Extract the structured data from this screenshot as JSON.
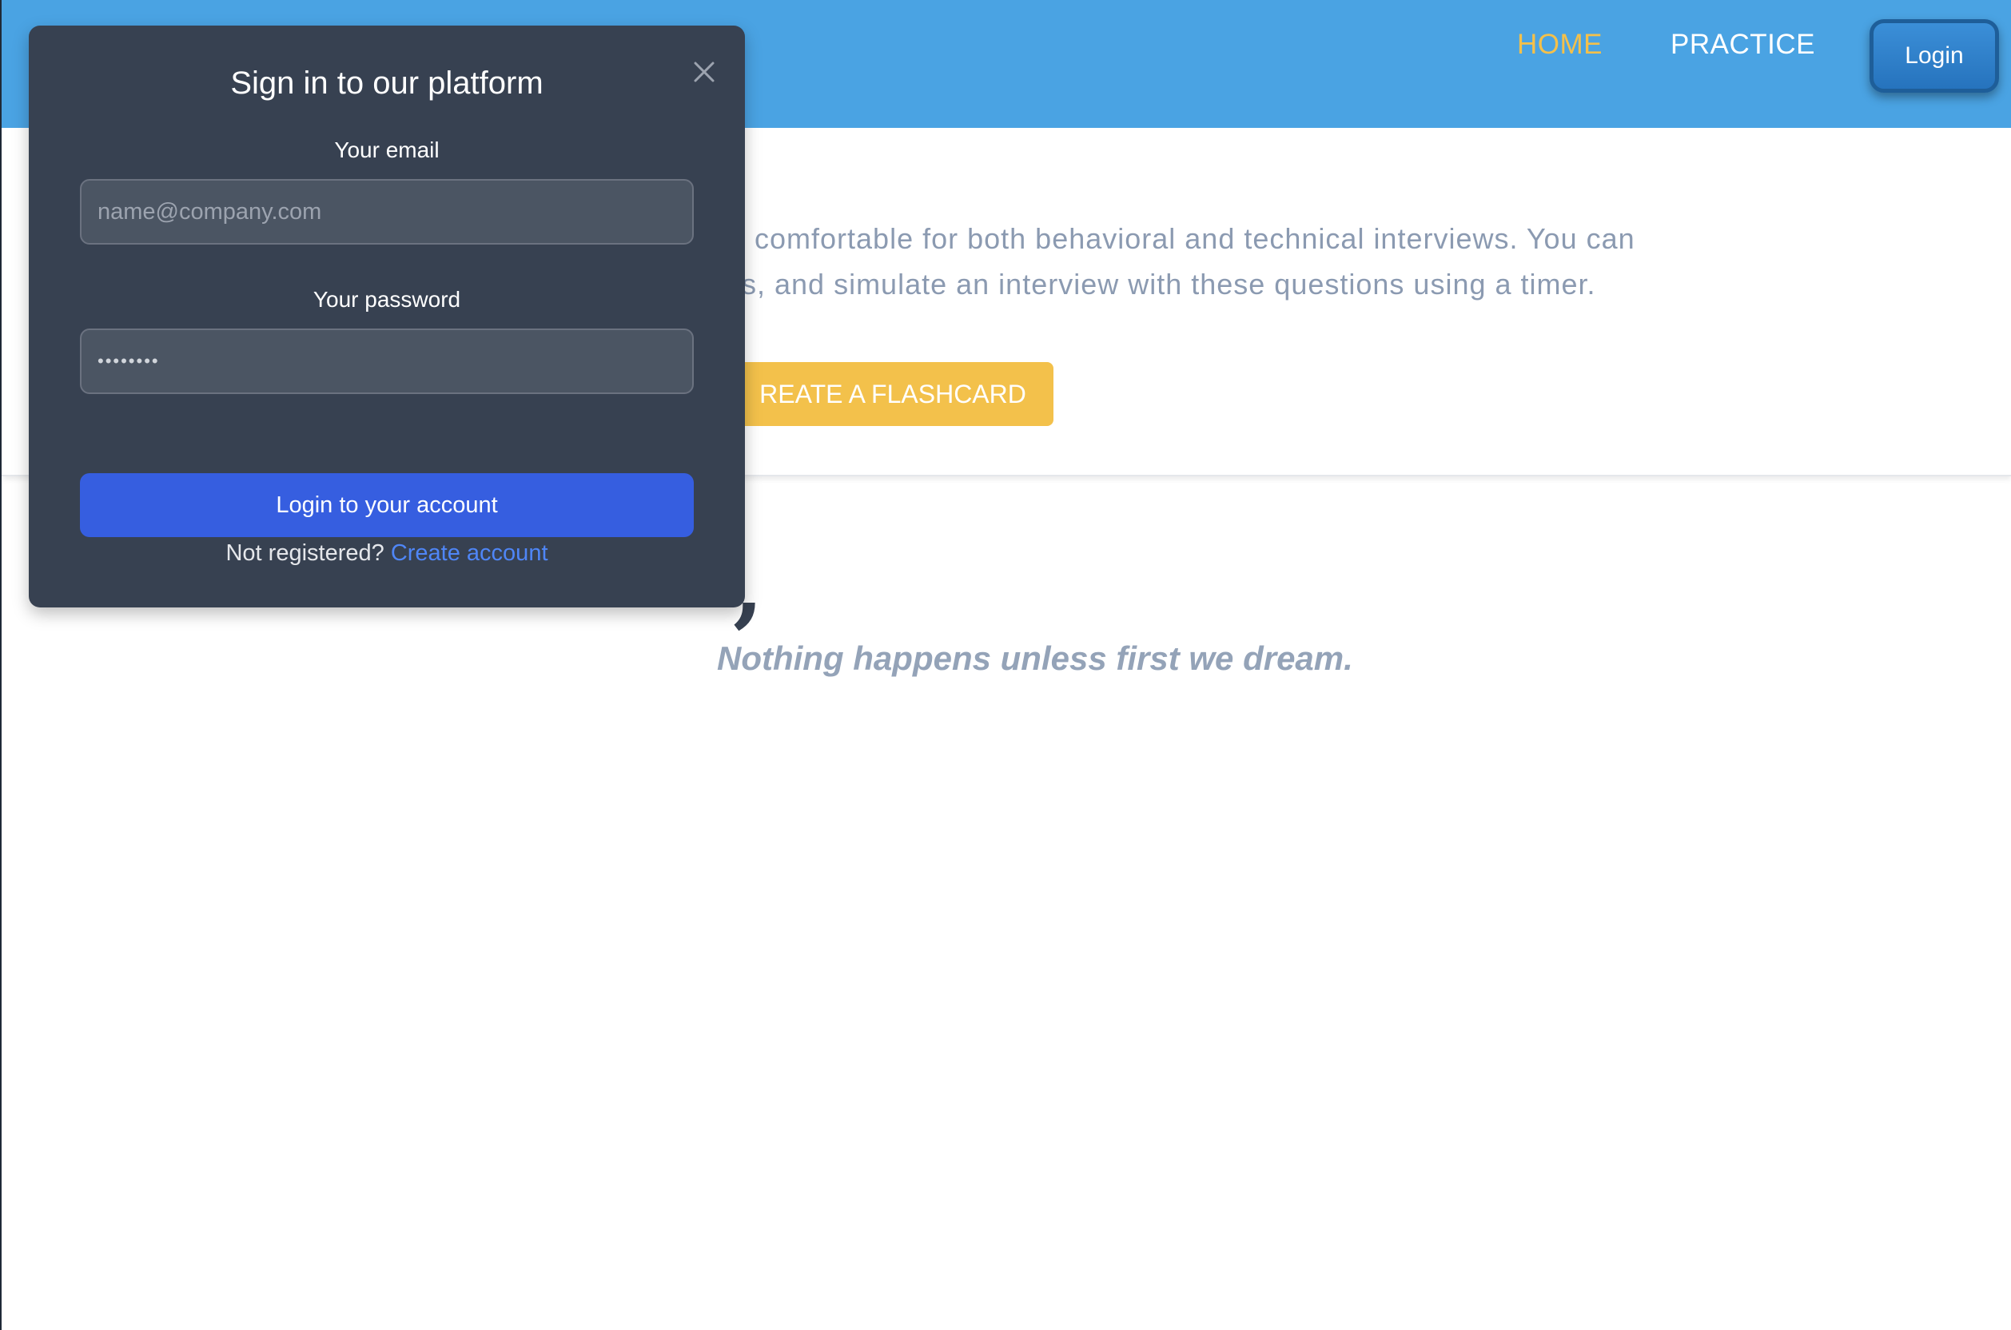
{
  "navbar": {
    "links": [
      {
        "label": "HOME",
        "active": true
      },
      {
        "label": "PRACTICE",
        "active": false
      }
    ],
    "login_label": "Login",
    "background_color": "#4aa3e3",
    "active_color": "#f4c04a"
  },
  "hero": {
    "line1": "comfortable for both behavioral and technical interviews. You can",
    "line2": "s, and simulate an interview with these questions using a timer.",
    "cta_label": "REATE A FLASHCARD",
    "cta_color": "#f3c14b"
  },
  "quote": {
    "mark": ",",
    "text": "Nothing happens unless first we dream."
  },
  "modal": {
    "title": "Sign in to our platform",
    "close_icon": "close-icon",
    "email_label": "Your email",
    "email_placeholder": "name@company.com",
    "email_value": "",
    "password_label": "Your password",
    "password_value": "••••••••",
    "submit_label": "Login to your account",
    "register_prompt": "Not registered?",
    "register_link": "Create account",
    "background_color": "#374151",
    "submit_color": "#365ee0"
  }
}
